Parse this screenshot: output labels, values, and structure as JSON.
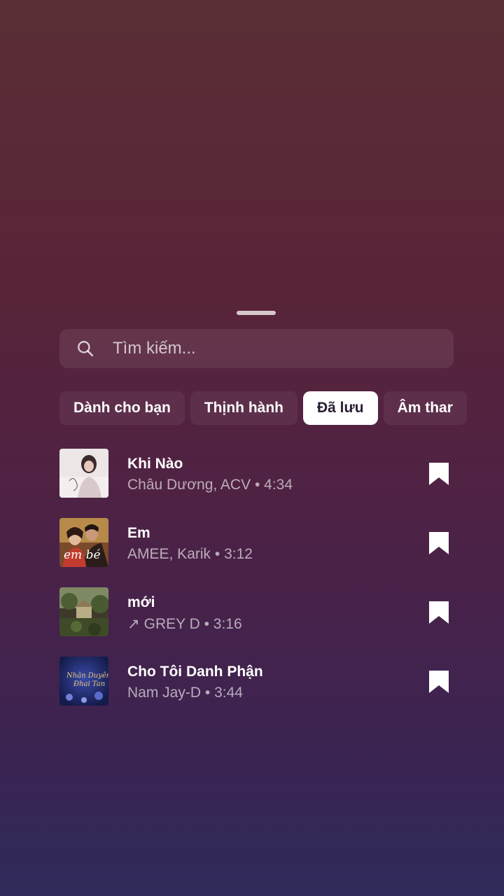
{
  "search": {
    "placeholder": "Tìm kiếm..."
  },
  "tabs": [
    {
      "label": "Dành cho bạn",
      "active": false
    },
    {
      "label": "Thịnh hành",
      "active": false
    },
    {
      "label": "Đã lưu",
      "active": true
    },
    {
      "label": "Âm thar",
      "active": false
    }
  ],
  "tracks": [
    {
      "title": "Khi Nào",
      "artist": "Châu Dương, ACV",
      "separator": "•",
      "duration": "4:34",
      "trending": false,
      "saved": true
    },
    {
      "title": "Em",
      "artist": "AMEE, Karik",
      "separator": "•",
      "duration": "3:12",
      "trending": false,
      "saved": true
    },
    {
      "title": "mới",
      "artist": "GREY D",
      "separator": "•",
      "duration": "3:16",
      "trending": true,
      "trend_symbol": "↗",
      "saved": true
    },
    {
      "title": "Cho Tôi Danh Phận",
      "artist": "Nam Jay-D",
      "separator": "•",
      "duration": "3:44",
      "trending": false,
      "saved": true
    }
  ],
  "colors": {
    "active_tab_bg": "#ffffff",
    "active_tab_text": "#2a1d33"
  },
  "icons": {
    "search": "search-icon",
    "bookmark": "bookmark-icon",
    "trend": "trending-arrow-icon"
  }
}
